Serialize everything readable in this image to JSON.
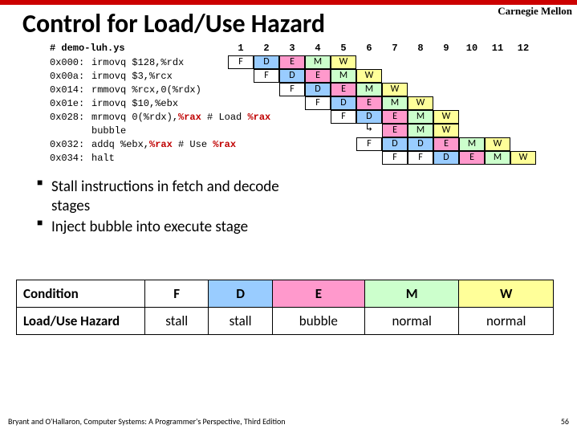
{
  "brand": "Carnegie Mellon",
  "title": "Control for Load/Use Hazard",
  "code_header": "# demo-luh.ys",
  "cycles": [
    "1",
    "2",
    "3",
    "4",
    "5",
    "6",
    "7",
    "8",
    "9",
    "10",
    "11",
    "12"
  ],
  "rows": [
    {
      "addr": "0x000:",
      "instr": "irmovq $128,%rdx",
      "lead": 0,
      "stages": [
        "F",
        "D",
        "E",
        "M",
        "W"
      ]
    },
    {
      "addr": "0x00a:",
      "instr": "irmovq $3,%rcx",
      "lead": 1,
      "stages": [
        "F",
        "D",
        "E",
        "M",
        "W"
      ]
    },
    {
      "addr": "0x014:",
      "instr": "rmmovq %rcx,0(%rdx)",
      "lead": 2,
      "stages": [
        "F",
        "D",
        "E",
        "M",
        "W"
      ]
    },
    {
      "addr": "0x01e:",
      "instr": "irmovq $10,%ebx",
      "lead": 3,
      "stages": [
        "F",
        "D",
        "E",
        "M",
        "W"
      ]
    },
    {
      "addr": "0x028:",
      "instr_html": "mrmovq 0(%rdx),<span class=\"hl\">%rax</span> # Load <span class=\"hl\">%rax</span>",
      "lead": 4,
      "stages": [
        "F",
        "D",
        "E",
        "M",
        "W"
      ]
    },
    {
      "addr": "",
      "instr": "bubble",
      "lead": 5,
      "stages": [
        "arrow",
        "E",
        "M",
        "W"
      ]
    },
    {
      "addr": "0x032:",
      "instr_html": "addq %ebx,<span class=\"hl\">%rax</span> # Use <span class=\"hl\">%rax</span>",
      "lead": 5,
      "stages": [
        "F",
        "D",
        "D",
        "E",
        "M",
        "W"
      ]
    },
    {
      "addr": "0x034:",
      "instr": "halt",
      "lead": 6,
      "stages": [
        "F",
        "F",
        "D",
        "E",
        "M",
        "W"
      ]
    }
  ],
  "bullets": [
    "Stall instructions in fetch and decode stages",
    "Inject bubble into execute stage"
  ],
  "table": {
    "head": [
      "Condition",
      "F",
      "D",
      "E",
      "M",
      "W"
    ],
    "row": [
      "Load/Use Hazard",
      "stall",
      "stall",
      "bubble",
      "normal",
      "normal"
    ]
  },
  "footer": "Bryant and O'Hallaron, Computer Systems: A Programmer's Perspective, Third Edition",
  "page": "56"
}
